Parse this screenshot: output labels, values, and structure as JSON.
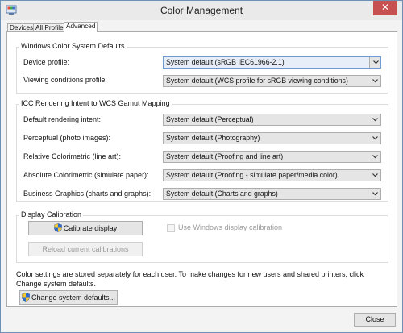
{
  "window": {
    "title": "Color Management",
    "close_label": "✕"
  },
  "tabs": [
    {
      "label": "Devices"
    },
    {
      "label": "All Profiles"
    },
    {
      "label": "Advanced"
    }
  ],
  "defaults_group": {
    "title": "Windows Color System Defaults",
    "rows": [
      {
        "label": "Device profile:",
        "value": "System default (sRGB IEC61966-2.1)"
      },
      {
        "label": "Viewing conditions profile:",
        "value": "System default (WCS profile for sRGB viewing conditions)"
      }
    ]
  },
  "icc_group": {
    "title": "ICC Rendering Intent to WCS Gamut Mapping",
    "rows": [
      {
        "label": "Default rendering intent:",
        "value": "System default (Perceptual)"
      },
      {
        "label": "Perceptual (photo images):",
        "value": "System default (Photography)"
      },
      {
        "label": "Relative Colorimetric (line art):",
        "value": "System default (Proofing and line art)"
      },
      {
        "label": "Absolute Colorimetric (simulate paper):",
        "value": "System default (Proofing - simulate paper/media color)"
      },
      {
        "label": "Business Graphics (charts and graphs):",
        "value": "System default (Charts and graphs)"
      }
    ]
  },
  "calibration_group": {
    "title": "Display Calibration",
    "calibrate_label": "Calibrate display",
    "reload_label": "Reload current calibrations",
    "use_windows_label": "Use Windows display calibration"
  },
  "info": {
    "text": "Color settings are stored separately for each user. To make changes for new users and shared printers, click Change system defaults."
  },
  "buttons": {
    "change_defaults": "Change system defaults...",
    "close": "Close"
  },
  "colors": {
    "window_border": "#6f8fb3",
    "close_red": "#c75050",
    "focus_blue": "#6d9bd1"
  }
}
